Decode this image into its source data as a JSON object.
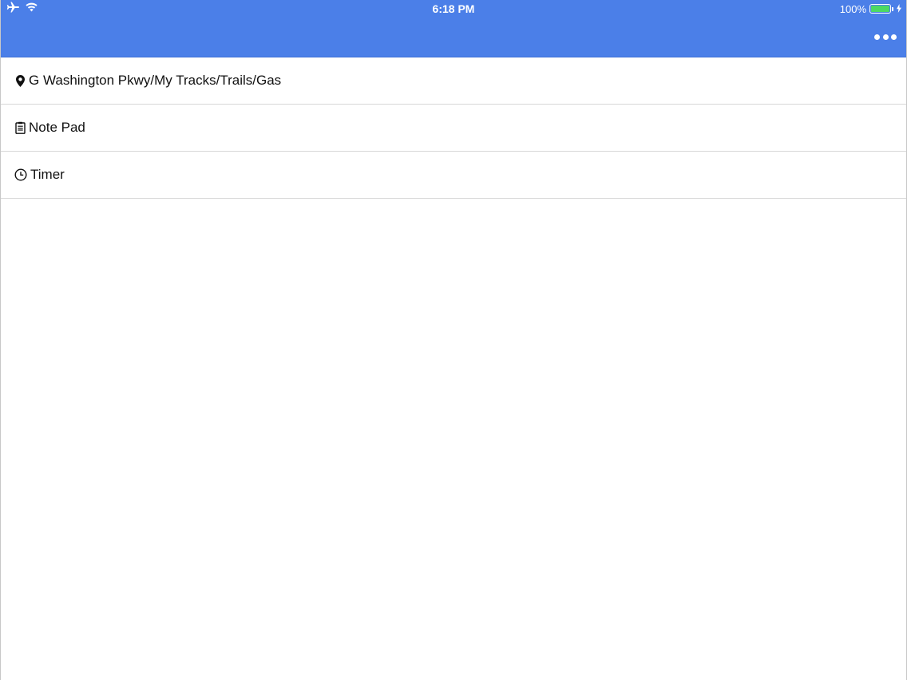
{
  "status_bar": {
    "time": "6:18 PM",
    "battery_percent": "100%",
    "battery_level": 1.0,
    "battery_color": "#4cd964",
    "icons": [
      "airplane-icon",
      "wifi-icon",
      "battery-icon",
      "charging-bolt-icon"
    ]
  },
  "header": {
    "background_color": "#4b7fe8",
    "more_icon": "ellipsis-icon"
  },
  "list": {
    "items": [
      {
        "label": "G Washington Pkwy/My Tracks/Trails/Gas",
        "icon": "map-marker-icon"
      },
      {
        "label": "Note Pad",
        "icon": "clipboard-icon"
      },
      {
        "label": "Timer",
        "icon": "clock-icon"
      }
    ]
  }
}
